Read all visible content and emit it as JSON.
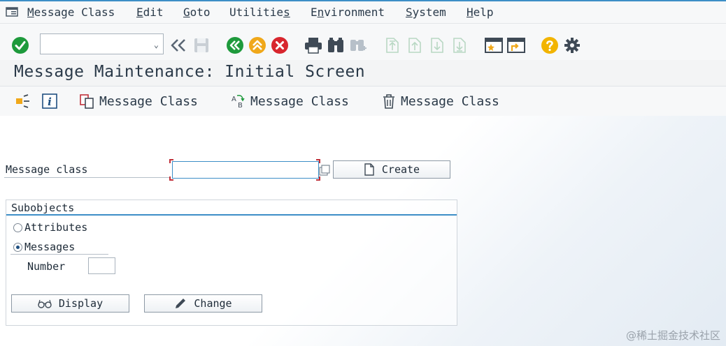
{
  "menubar": {
    "items": [
      {
        "label": "Message Class",
        "mnemonic": "M",
        "rest": "essage Class"
      },
      {
        "label": "Edit",
        "mnemonic": "E",
        "rest": "dit"
      },
      {
        "label": "Goto",
        "mnemonic": "G",
        "rest": "oto"
      },
      {
        "label": "Utilities",
        "pre": "Utilitie",
        "mnemonic": "s",
        "rest": ""
      },
      {
        "label": "Environment",
        "pre": "E",
        "mnemonic": "n",
        "rest": "vironment"
      },
      {
        "label": "System",
        "mnemonic": "S",
        "rest": "ystem"
      },
      {
        "label": "Help",
        "mnemonic": "H",
        "rest": "elp"
      }
    ]
  },
  "toolbar": {
    "command_field": {
      "value": "",
      "placeholder": ""
    },
    "icons": [
      "enter-icon",
      "back-double-chevron-icon",
      "save-icon",
      "back-green-icon",
      "exit-orange-icon",
      "cancel-red-icon",
      "print-icon",
      "find-icon",
      "find-next-icon",
      "first-page-icon",
      "previous-page-icon",
      "next-page-icon",
      "last-page-icon",
      "create-session-icon",
      "shortcut-icon",
      "help-icon",
      "settings-icon"
    ]
  },
  "title": {
    "text": "Message Maintenance: Initial Screen"
  },
  "app_toolbar": {
    "buttons": [
      {
        "icon": "where-used-icon",
        "label": ""
      },
      {
        "icon": "info-icon",
        "label": ""
      },
      {
        "icon": "copy-icon",
        "label": "Message Class"
      },
      {
        "icon": "rename-icon",
        "label": "Message Class"
      },
      {
        "icon": "delete-trash-icon",
        "label": "Message Class"
      }
    ]
  },
  "main": {
    "message_class_label": "Message class",
    "message_class_value": "",
    "create_button": "Create",
    "subobjects": {
      "title": "Subobjects",
      "radios": [
        {
          "label": "Attributes",
          "checked": false
        },
        {
          "label": "Messages",
          "checked": true
        }
      ],
      "number_label": "Number",
      "number_value": ""
    },
    "display_button": "Display",
    "change_button": "Change"
  },
  "watermark": "@稀土掘金技术社区",
  "colors": {
    "accent": "#3d8ec7",
    "green": "#1e9a3c",
    "orange": "#f0a81a",
    "red": "#d8262e",
    "help": "#f2b400"
  }
}
